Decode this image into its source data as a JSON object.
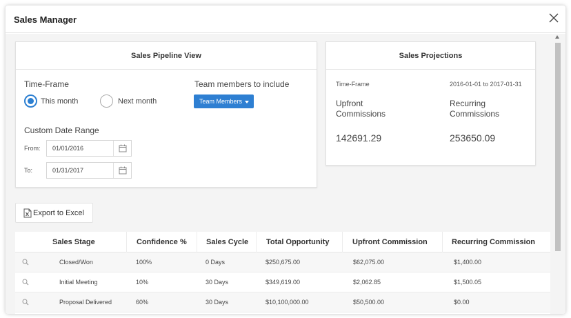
{
  "dialog": {
    "title": "Sales Manager",
    "close_icon": "close-icon"
  },
  "pipeline": {
    "header": "Sales Pipeline View",
    "timeframe_label": "Time-Frame",
    "options": [
      {
        "label": "This month",
        "selected": true
      },
      {
        "label": "Next month",
        "selected": false
      }
    ],
    "team_label": "Team members to include",
    "team_button": "Team Members",
    "custom_range_label": "Custom Date Range",
    "from_label": "From:",
    "from_value": "01/01/2016",
    "to_label": "To:",
    "to_value": "01/31/2017",
    "calendar_icon": "calendar-icon"
  },
  "projections": {
    "header": "Sales Projections",
    "timeframe_label": "Time-Frame",
    "timeframe_value": "2016-01-01 to 2017-01-31",
    "upfront_label_1": "Upfront",
    "upfront_label_2": "Commissions",
    "recurring_label_1": "Recurring",
    "recurring_label_2": "Commissions",
    "upfront_value": "142691.29",
    "recurring_value": "253650.09"
  },
  "export": {
    "label": "Export to Excel",
    "icon": "excel-icon"
  },
  "table": {
    "columns": [
      "Sales Stage",
      "Confidence %",
      "Sales Cycle",
      "Total Opportunity",
      "Upfront Commission",
      "Recurring Commission"
    ],
    "rows": [
      {
        "stage": "Closed/Won",
        "confidence": "100%",
        "cycle": "0 Days",
        "total": "$250,675.00",
        "upfront": "$62,075.00",
        "recurring": "$1,400.00"
      },
      {
        "stage": "Initial Meeting",
        "confidence": "10%",
        "cycle": "30 Days",
        "total": "$349,619.00",
        "upfront": "$2,062.85",
        "recurring": "$1,500.05"
      },
      {
        "stage": "Proposal Delivered",
        "confidence": "60%",
        "cycle": "30 Days",
        "total": "$10,100,000.00",
        "upfront": "$50,500.00",
        "recurring": "$0.00"
      }
    ],
    "row_icon": "magnifier-icon"
  },
  "colors": {
    "accent": "#2e7fd2",
    "background": "#f4f4f4",
    "card": "#ffffff"
  }
}
